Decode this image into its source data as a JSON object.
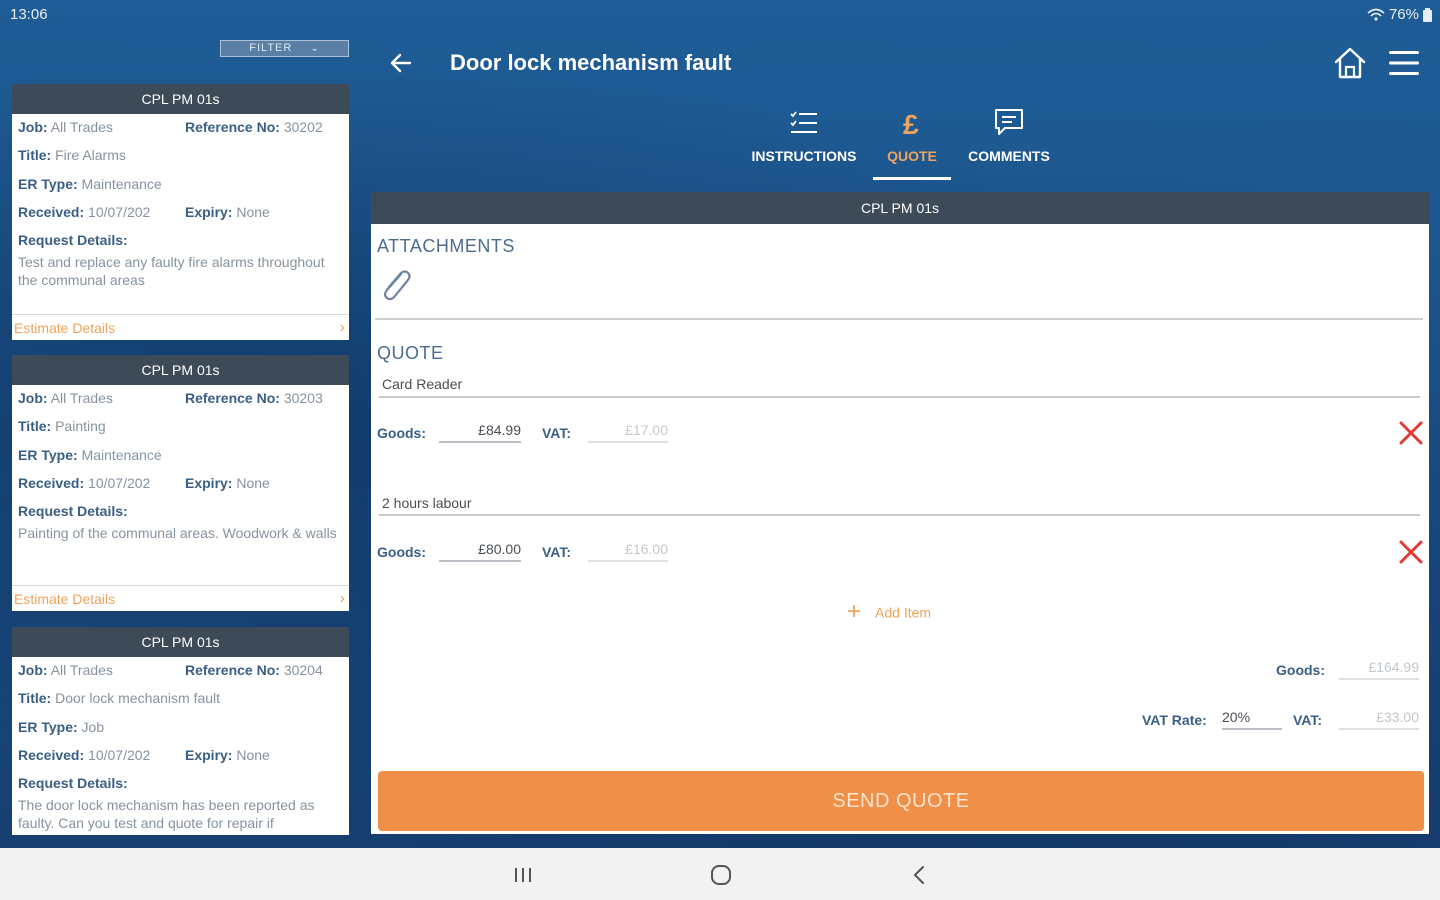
{
  "status_bar": {
    "time": "13:06",
    "battery": "76%"
  },
  "filter": {
    "label": "FILTER"
  },
  "jobs": [
    {
      "header": "CPL PM 01s",
      "job_label": "Job:",
      "job": "All Trades",
      "ref_label": "Reference No:",
      "ref": "30202",
      "title_label": "Title:",
      "title": "Fire Alarms",
      "er_label": "ER Type:",
      "er_type": "Maintenance",
      "received_label": "Received:",
      "received": "10/07/202",
      "expiry_label": "Expiry:",
      "expiry": "None",
      "details_label": "Request Details:",
      "details": "Test and replace any faulty fire alarms throughout the communal areas",
      "footer": "Estimate Details"
    },
    {
      "header": "CPL PM 01s",
      "job_label": "Job:",
      "job": "All Trades",
      "ref_label": "Reference No:",
      "ref": "30203",
      "title_label": "Title:",
      "title": "Painting",
      "er_label": "ER Type:",
      "er_type": "Maintenance",
      "received_label": "Received:",
      "received": "10/07/202",
      "expiry_label": "Expiry:",
      "expiry": "None",
      "details_label": "Request Details:",
      "details": "Painting of the communal areas. Woodwork & walls",
      "footer": "Estimate Details"
    },
    {
      "header": "CPL PM 01s",
      "job_label": "Job:",
      "job": "All Trades",
      "ref_label": "Reference No:",
      "ref": "30204",
      "title_label": "Title:",
      "title": "Door lock mechanism fault",
      "er_label": "ER Type:",
      "er_type": "Job",
      "received_label": "Received:",
      "received": "10/07/202",
      "expiry_label": "Expiry:",
      "expiry": "None",
      "details_label": "Request Details:",
      "details": "The door lock mechanism has been reported as faulty. Can you test and quote for repair if"
    }
  ],
  "header": {
    "title": "Door lock mechanism fault"
  },
  "tabs": [
    {
      "label": "INSTRUCTIONS",
      "icon": "checklist-icon"
    },
    {
      "label": "QUOTE",
      "icon": "pound-icon",
      "active": true
    },
    {
      "label": "COMMENTS",
      "icon": "comment-icon"
    }
  ],
  "panel": {
    "header": "CPL PM 01s",
    "attachments_title": "ATTACHMENTS",
    "quote_title": "QUOTE",
    "items": [
      {
        "name": "Card Reader",
        "goods_label": "Goods:",
        "goods": "£84.99",
        "vat_label": "VAT:",
        "vat": "£17.00"
      },
      {
        "name": "2 hours labour",
        "goods_label": "Goods:",
        "goods": "£80.00",
        "vat_label": "VAT:",
        "vat": "£16.00"
      }
    ],
    "add_item": "Add Item",
    "totals": {
      "goods_label": "Goods:",
      "goods": "£164.99",
      "vat_rate_label": "VAT Rate:",
      "vat_rate": "20%",
      "vat_label": "VAT:",
      "vat": "£33.00"
    },
    "send_button": "SEND QUOTE"
  },
  "colors": {
    "accent": "#f08f48",
    "header_dark": "#3d4a57",
    "label_blue": "#3a5f86",
    "delete_red": "#e53935"
  }
}
